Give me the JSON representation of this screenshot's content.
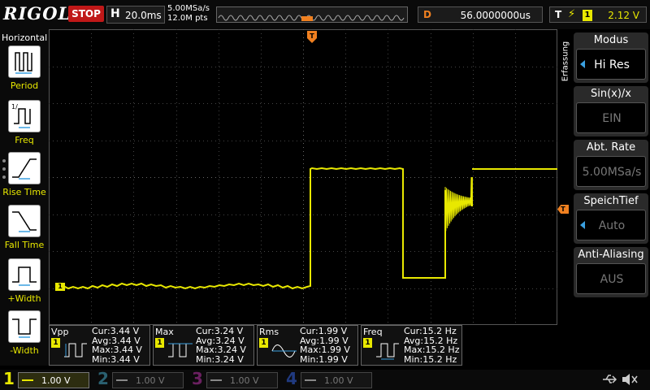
{
  "header": {
    "logo": "RIGOL",
    "run_status": "STOP",
    "timebase_key": "H",
    "timebase": "20.0ms",
    "sample_rate": "5.00MSa/s",
    "memory_points": "12.0M pts",
    "delay_key": "D",
    "delay": "56.0000000us",
    "trigger_key": "T",
    "trigger_channel": "1",
    "trigger_level": "2.12 V"
  },
  "left_menu": {
    "title": "Horizontal",
    "items": [
      {
        "label": "Period",
        "icon": "period-icon"
      },
      {
        "label": "Freq",
        "icon": "freq-icon"
      },
      {
        "label": "Rise Time",
        "icon": "rise-time-icon"
      },
      {
        "label": "Fall Time",
        "icon": "fall-time-icon"
      },
      {
        "label": "+Width",
        "icon": "pos-width-icon"
      },
      {
        "label": "-Width",
        "icon": "neg-width-icon"
      }
    ]
  },
  "right_menu": {
    "section": "Erfassung",
    "items": [
      {
        "title": "Modus",
        "value": "Hi Res",
        "active": true
      },
      {
        "title": "Sin(x)/x",
        "value": "EIN",
        "active": false
      },
      {
        "title": "Abt. Rate",
        "value": "5.00MSa/s",
        "active": false
      },
      {
        "title": "SpeichTief",
        "value": "Auto",
        "active": true
      },
      {
        "title": "Anti-Aliasing",
        "value": "AUS",
        "active": false
      }
    ]
  },
  "markers": {
    "channel_marker": "1",
    "trigger_level_marker": "T"
  },
  "measurements": [
    {
      "name": "Vpp",
      "channel": "1",
      "cur": "Cur:3.44 V",
      "avg": "Avg:3.44 V",
      "max": "Max:3.44 V",
      "min": "Min:3.44 V"
    },
    {
      "name": "Max",
      "channel": "1",
      "cur": "Cur:3.24 V",
      "avg": "Avg:3.24 V",
      "max": "Max:3.24 V",
      "min": "Min:3.24 V"
    },
    {
      "name": "Rms",
      "channel": "1",
      "cur": "Cur:1.99 V",
      "avg": "Avg:1.99 V",
      "max": "Max:1.99 V",
      "min": "Min:1.99 V"
    },
    {
      "name": "Freq",
      "channel": "1",
      "cur": "Cur:15.2 Hz",
      "avg": "Avg:15.2 Hz",
      "max": "Max:15.2 Hz",
      "min": "Min:15.2 Hz"
    }
  ],
  "channels": [
    {
      "num": "1",
      "scale": "1.00 V",
      "active": true
    },
    {
      "num": "2",
      "scale": "1.00 V",
      "active": false
    },
    {
      "num": "3",
      "scale": "1.00 V",
      "active": false
    },
    {
      "num": "4",
      "scale": "1.00 V",
      "active": false
    }
  ],
  "colors": {
    "ch1": "#e8e800",
    "ch2": "#40c0e0",
    "ch3": "#e040c0",
    "ch4": "#2060e0",
    "trigger": "#f08020",
    "stop": "#c01818"
  }
}
